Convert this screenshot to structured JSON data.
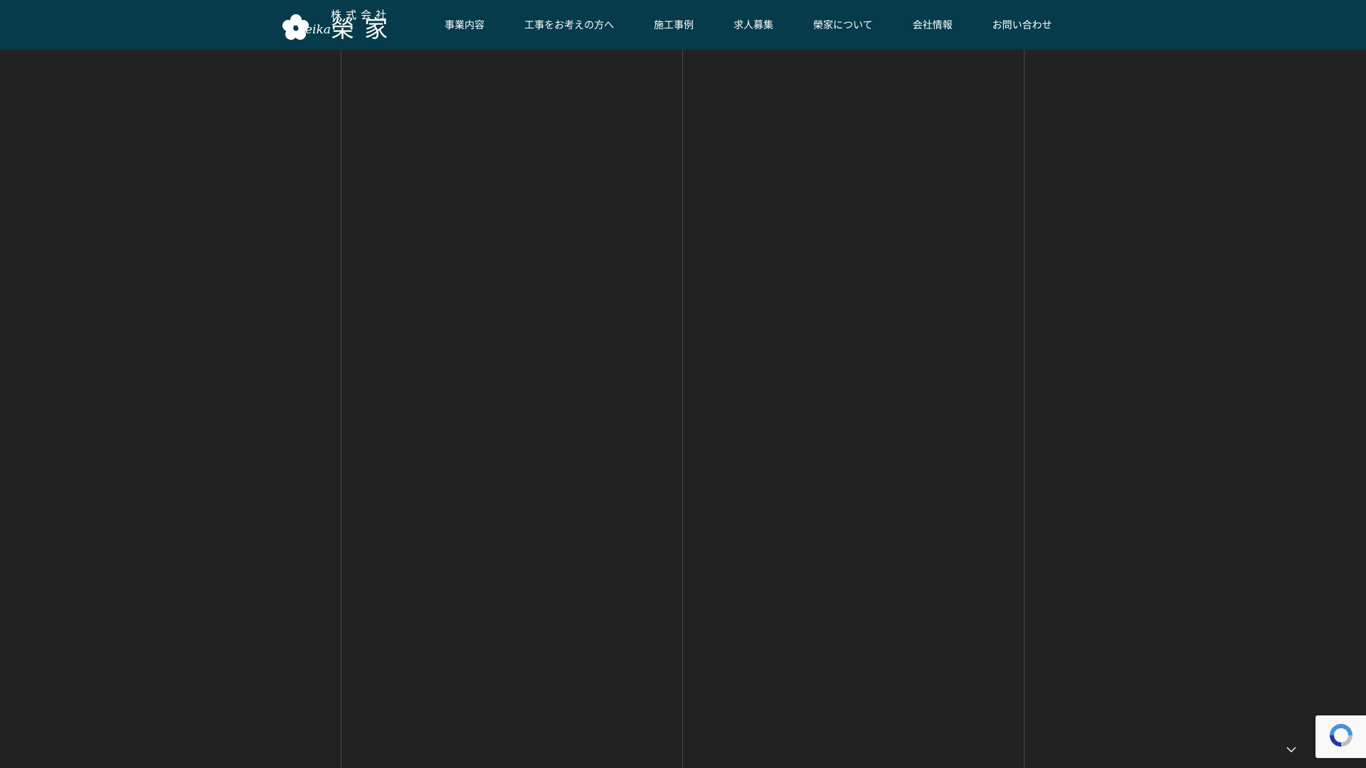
{
  "header": {
    "logo": {
      "small_text": "株式会社",
      "script_text": "eika",
      "kanji": "榮家"
    },
    "nav": [
      {
        "label": "事業内容"
      },
      {
        "label": "工事をお考えの方へ"
      },
      {
        "label": "施工事例"
      },
      {
        "label": "求人募集"
      },
      {
        "label": "榮家について"
      },
      {
        "label": "会社情報"
      },
      {
        "label": "お問い合わせ"
      }
    ]
  },
  "colors": {
    "header_bg": "#053b4a",
    "page_bg": "#222222",
    "grid_line": "#4a4a4a",
    "text": "#ffffff"
  },
  "icons": {
    "logo_mark": "flower-icon",
    "recaptcha": "recaptcha-icon",
    "scroll": "chevron-down-icon"
  }
}
